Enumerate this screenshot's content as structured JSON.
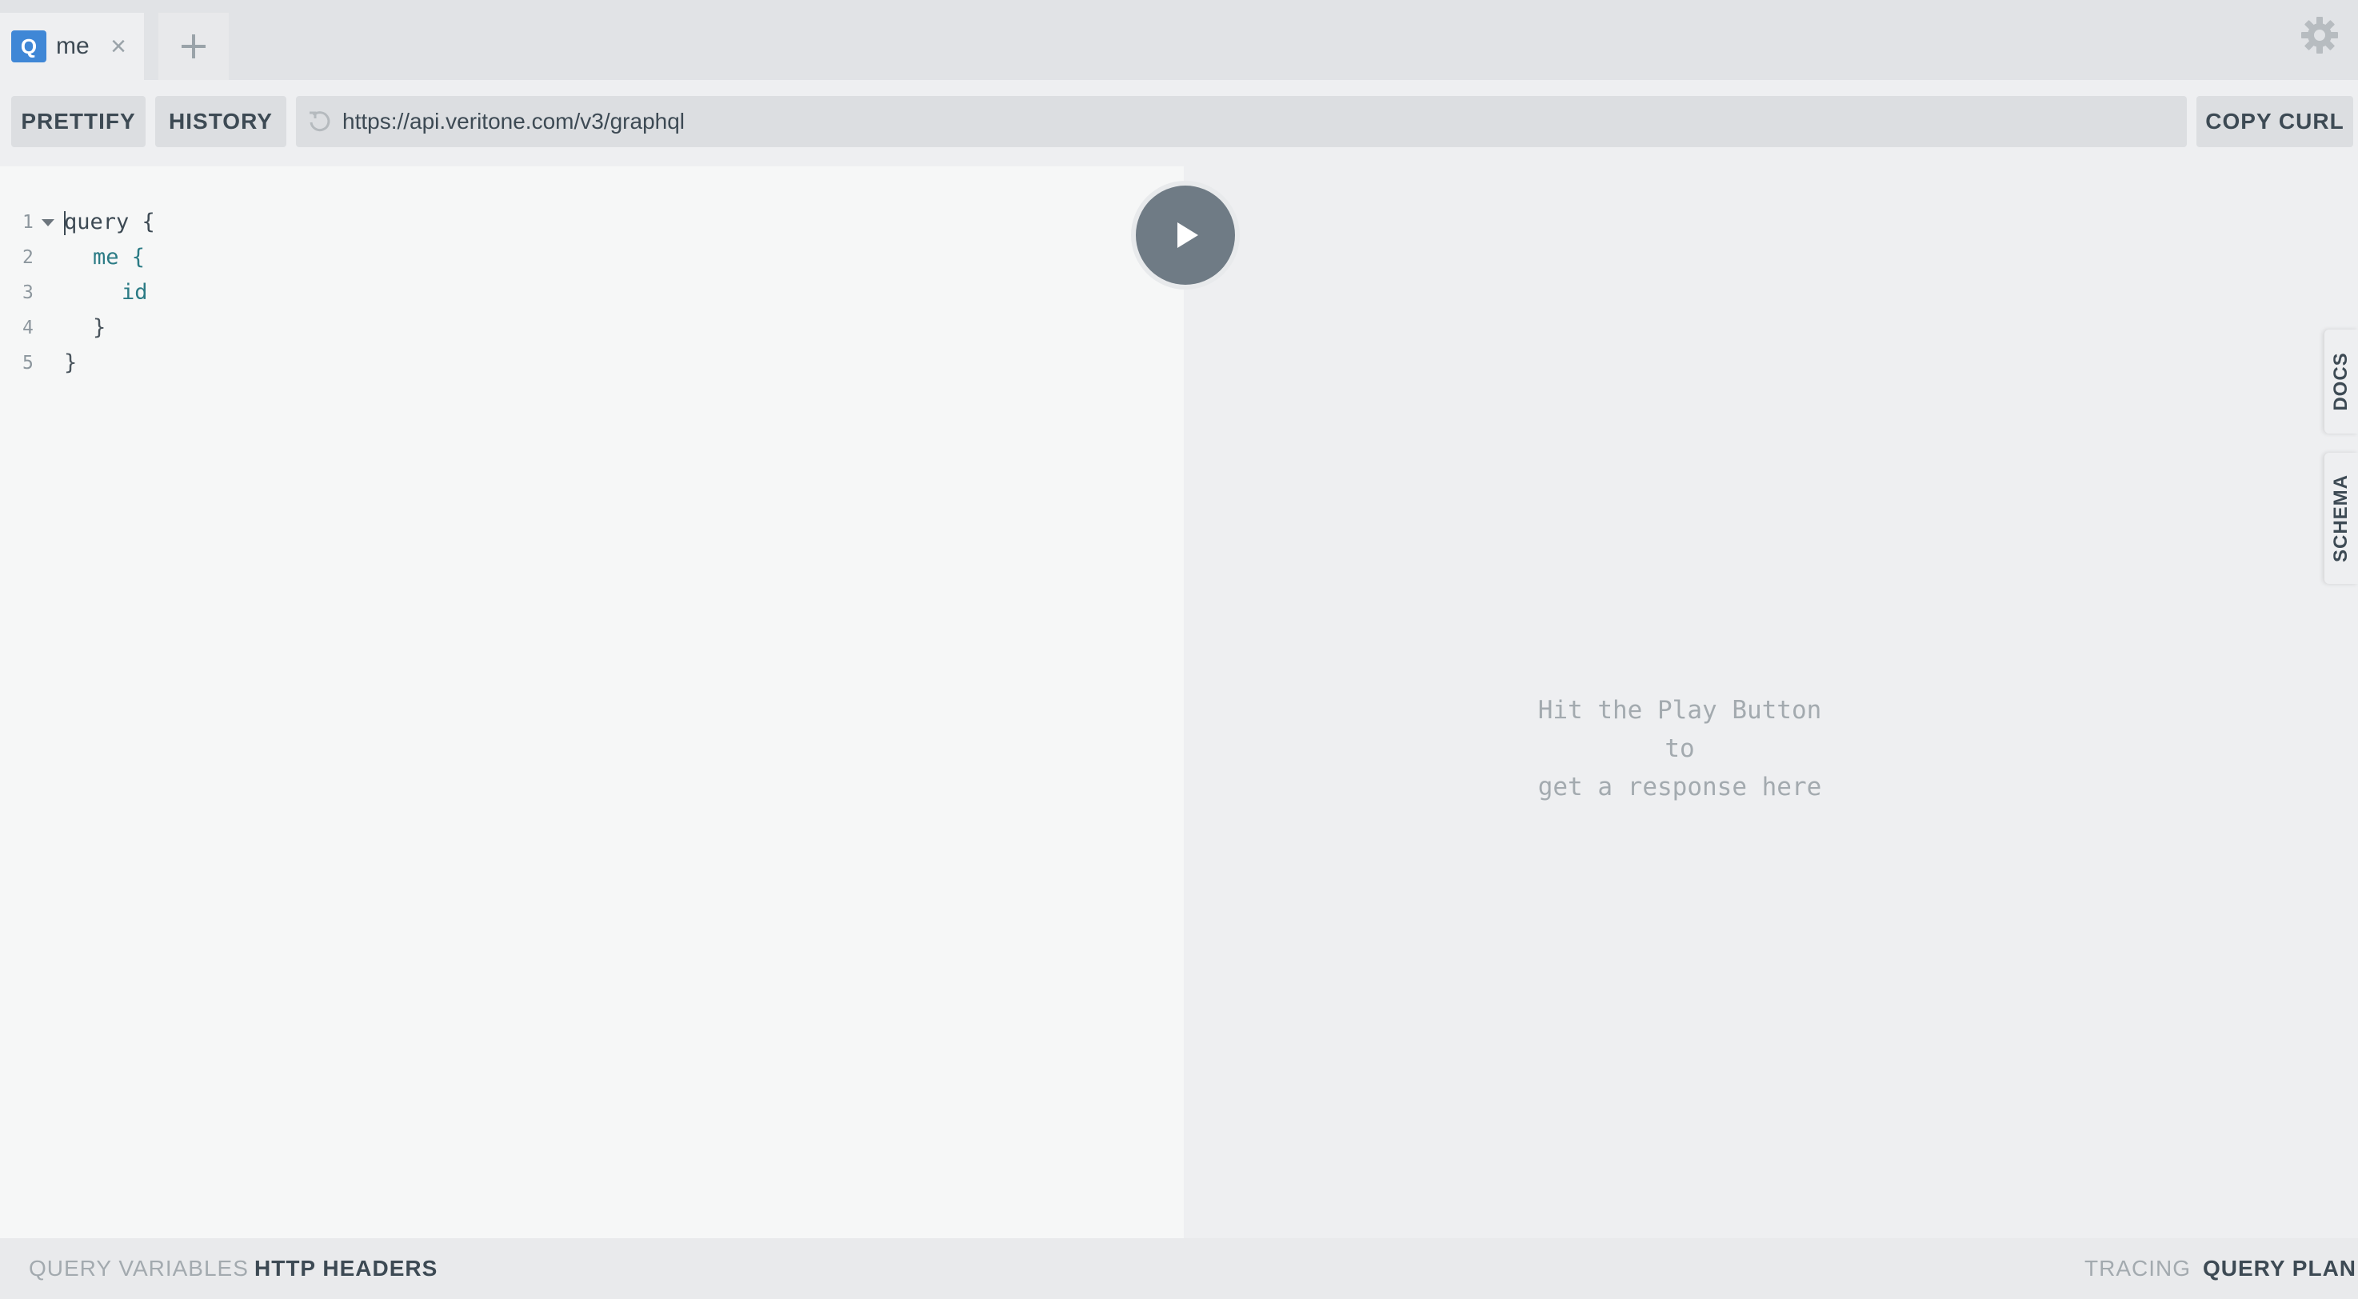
{
  "tabs": [
    {
      "badge": "Q",
      "label": "me",
      "close": "×"
    }
  ],
  "toolbar": {
    "prettify_label": "PRETTIFY",
    "history_label": "HISTORY",
    "url": "https://api.veritone.com/v3/graphql",
    "copy_curl_label": "COPY CURL"
  },
  "editor": {
    "lines": [
      {
        "num": "1",
        "text": "query {"
      },
      {
        "num": "2",
        "text": "me {"
      },
      {
        "num": "3",
        "text": "id"
      },
      {
        "num": "4",
        "text": "}"
      },
      {
        "num": "5",
        "text": "}"
      }
    ]
  },
  "result": {
    "placeholder_line1": "Hit the Play Button to",
    "placeholder_line2": "get a response here"
  },
  "side_tabs": {
    "docs": "DOCS",
    "schema": "SCHEMA"
  },
  "bottom": {
    "query_variables": "QUERY VARIABLES",
    "http_headers": "HTTP HEADERS",
    "tracing": "TRACING",
    "query_plan": "QUERY PLAN"
  },
  "icons": {
    "add_tab": "plus-icon",
    "settings": "gear-icon",
    "refresh": "refresh-icon",
    "play": "play-icon",
    "fold": "chevron-down-icon"
  },
  "colors": {
    "accent": "#3f87d6",
    "play_button": "#6f7b85",
    "field": "#2b7b85"
  }
}
